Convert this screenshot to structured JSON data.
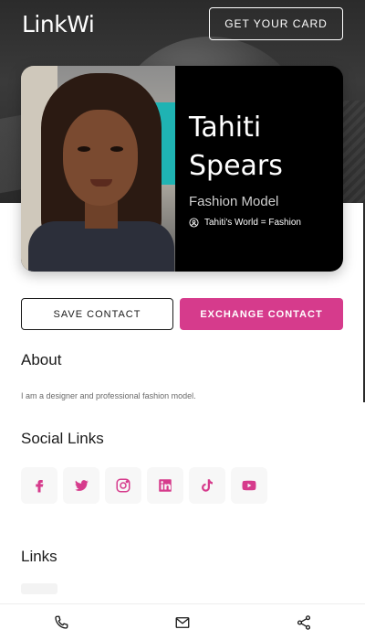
{
  "brand": {
    "logo_text": "LinkWi"
  },
  "header": {
    "get_card_label": "GET YOUR CARD"
  },
  "profile": {
    "first_name": "Tahiti",
    "last_name": "Spears",
    "title": "Fashion Model",
    "organization": "Tahiti's World = Fashion"
  },
  "actions": {
    "save_label": "SAVE CONTACT",
    "exchange_label": "EXCHANGE CONTACT"
  },
  "about": {
    "heading": "About",
    "text": "I am a designer and professional fashion model."
  },
  "social": {
    "heading": "Social Links",
    "items": [
      {
        "icon": "facebook-icon"
      },
      {
        "icon": "twitter-icon"
      },
      {
        "icon": "instagram-icon"
      },
      {
        "icon": "linkedin-icon"
      },
      {
        "icon": "tiktok-icon"
      },
      {
        "icon": "youtube-icon"
      }
    ]
  },
  "links": {
    "heading": "Links"
  },
  "bottom_nav": [
    {
      "icon": "phone-icon"
    },
    {
      "icon": "mail-icon"
    },
    {
      "icon": "share-icon"
    }
  ],
  "colors": {
    "accent": "#d63b8c",
    "card_bg": "#000000",
    "hero_bg": "#2b2b2b"
  }
}
